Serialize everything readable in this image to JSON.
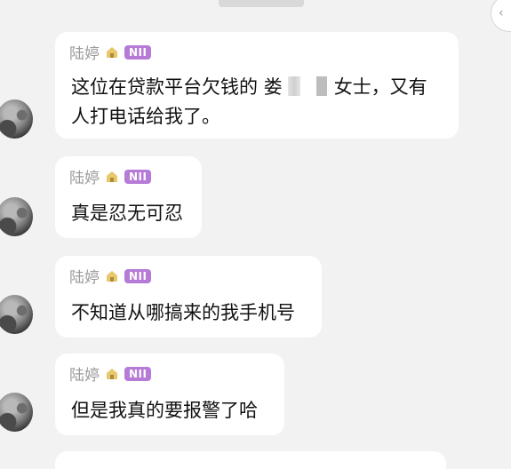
{
  "chat": {
    "messages": [
      {
        "sender": "陆婷",
        "badge": "NII",
        "text_a": "这位在贷款平台欠钱的 娄",
        "text_b": "女士，又有",
        "text_c": "人打电话给我了。"
      },
      {
        "sender": "陆婷",
        "badge": "NII",
        "text": "真是忍无可忍"
      },
      {
        "sender": "陆婷",
        "badge": "NII",
        "text": "不知道从哪搞来的我手机号"
      },
      {
        "sender": "陆婷",
        "badge": "NII",
        "text": "但是我真的要报警了哈"
      }
    ]
  },
  "icons": {
    "home": "house-icon",
    "corner": "chevron-icon"
  },
  "colors": {
    "badge": "#b67bd7",
    "bubble": "#ffffff",
    "background": "#f2f2f2"
  }
}
